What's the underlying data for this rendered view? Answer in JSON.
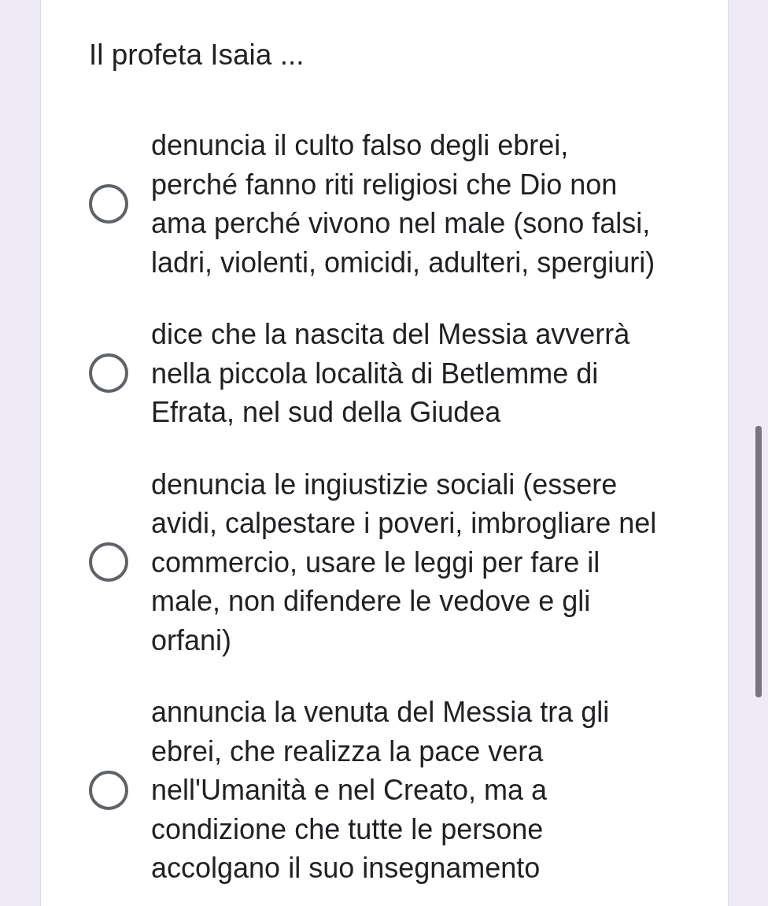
{
  "question": {
    "title": "Il profeta Isaia ..."
  },
  "options": [
    {
      "label": "denuncia il culto falso degli ebrei,\nperché fanno riti religiosi che Dio non ama perché vivono nel male (sono falsi, ladri, violenti, omicidi, adulteri, spergiuri)",
      "selected": false
    },
    {
      "label": "dice che la nascita del Messia avverrà nella piccola località di Betlemme di Efrata, nel sud della Giudea",
      "selected": false
    },
    {
      "label": "denuncia le ingiustizie sociali (essere avidi, calpestare i poveri, imbrogliare nel commercio, usare le leggi per fare il male, non difendere le vedove e gli orfani)",
      "selected": false
    },
    {
      "label": "annuncia la venuta del Messia tra gli ebrei, che realizza la pace vera nell'Umanità e nel Creato, ma a condizione che tutte le persone accolgano il suo insegnamento",
      "selected": false
    }
  ]
}
